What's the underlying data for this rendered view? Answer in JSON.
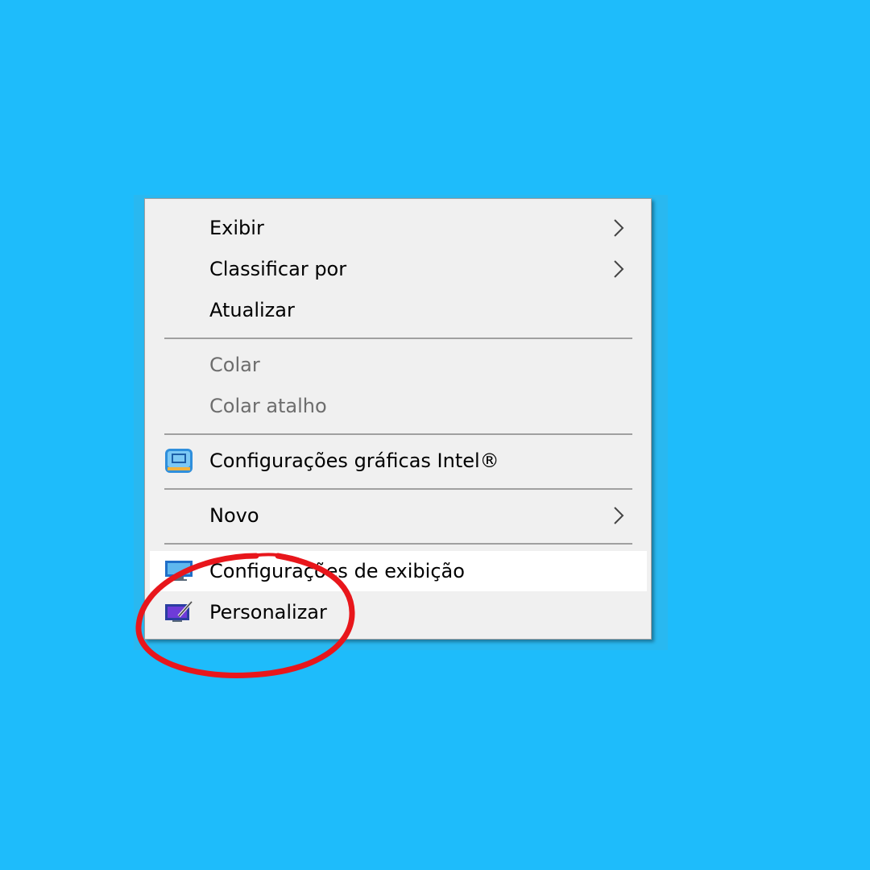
{
  "colors": {
    "desktop": "#1ebcfb",
    "menu_background": "#f0f0f0",
    "hover_background": "#ffffff",
    "separator": "#a0a0a0",
    "disabled_text": "#6d6d6d",
    "annotation": "#e8161b"
  },
  "menu": {
    "items": [
      {
        "label": "Exibir",
        "submenu": true
      },
      {
        "label": "Classificar por",
        "submenu": true
      },
      {
        "label": "Atualizar"
      },
      {
        "label": "Colar",
        "disabled": true
      },
      {
        "label": "Colar atalho",
        "disabled": true
      },
      {
        "label": "Configurações gráficas Intel®",
        "icon": "intel-graphics-icon"
      },
      {
        "label": "Novo",
        "submenu": true
      },
      {
        "label": "Configurações de exibição",
        "icon": "display-settings-icon",
        "highlighted": true
      },
      {
        "label": "Personalizar",
        "icon": "personalize-icon"
      }
    ]
  }
}
